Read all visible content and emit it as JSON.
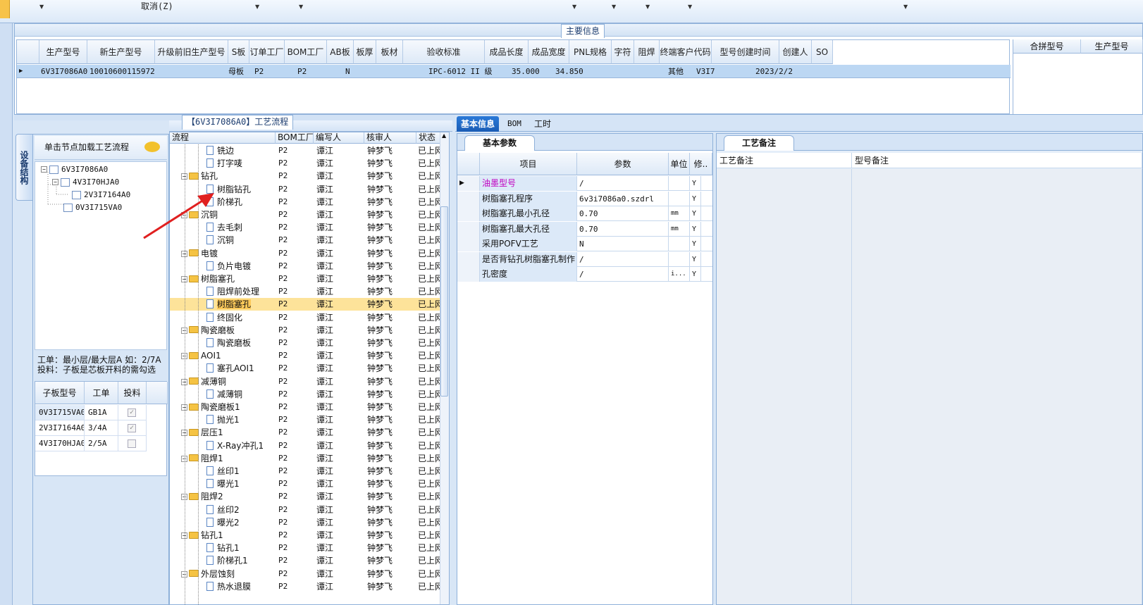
{
  "toolbar": {
    "cancel_label": "取消(Z)"
  },
  "main_info": {
    "title": "主要信息",
    "columns": [
      "生产型号",
      "新生产型号",
      "升级前旧生产型号",
      "S板",
      "订单工厂",
      "BOM工厂",
      "AB板",
      "板厚",
      "板材",
      "验收标准",
      "成品长度",
      "成品宽度",
      "PNL规格",
      "字符",
      "阻焊",
      "终端客户代码",
      "型号创建时间",
      "创建人",
      "SO"
    ],
    "row": {
      "prod_model": "6V3I7086A0",
      "new_model": "10010600115972",
      "old_model": "",
      "s_board": "母板",
      "order_factory": "P2",
      "bom_factory": "P2",
      "ab": "N",
      "thickness": "",
      "material": "",
      "standard": "IPC-6012 II 级",
      "length": "35.000",
      "width": "34.850",
      "pnl": "",
      "char": "",
      "mask": "其他",
      "customer": "V3I7",
      "created": "2023/2/2",
      "creator": "",
      "so": ""
    },
    "right_columns": [
      "合拼型号",
      "生产型号"
    ]
  },
  "structure": {
    "tab_label": "设备结构",
    "hint": "单击节点加载工艺流程",
    "tree": [
      "6V3I7086A0",
      "4V3I70HJA0",
      "2V3I7164A0",
      "0V3I715VA0"
    ],
    "info_line1": "工单：最小层/最大层A 如：2/7A",
    "info_line2": "投料：子板是芯板开料的需勾选",
    "sub_columns": [
      "子板型号",
      "工单",
      "投料"
    ],
    "sub_rows": [
      {
        "model": "0V3I715VA0",
        "order": "GB1A",
        "checked": true
      },
      {
        "model": "2V3I7164A0",
        "order": "3/4A",
        "checked": true
      },
      {
        "model": "4V3I70HJA0",
        "order": "2/5A",
        "checked": false
      }
    ]
  },
  "process": {
    "title": "【6V3I7086A0】工艺流程",
    "columns": [
      "流程",
      "BOM工厂",
      "编写人",
      "核审人",
      "状态"
    ],
    "default_factory": "P2",
    "default_writer": "谭江",
    "default_reviewer": "钟梦飞",
    "default_status": "已上网",
    "rows": [
      {
        "name": "铣边",
        "level": 2
      },
      {
        "name": "打字唛",
        "level": 2
      },
      {
        "name": "钻孔",
        "level": 1
      },
      {
        "name": "树脂钻孔",
        "level": 2
      },
      {
        "name": "阶梯孔",
        "level": 2
      },
      {
        "name": "沉铜",
        "level": 1
      },
      {
        "name": "去毛刺",
        "level": 2
      },
      {
        "name": "沉铜",
        "level": 2
      },
      {
        "name": "电镀",
        "level": 1
      },
      {
        "name": "负片电镀",
        "level": 2
      },
      {
        "name": "树脂塞孔",
        "level": 1
      },
      {
        "name": "阻焊前处理",
        "level": 2
      },
      {
        "name": "树脂塞孔",
        "level": 2,
        "selected": true
      },
      {
        "name": "终固化",
        "level": 2
      },
      {
        "name": "陶瓷磨板",
        "level": 1
      },
      {
        "name": "陶瓷磨板",
        "level": 2
      },
      {
        "name": "AOI1",
        "level": 1
      },
      {
        "name": "塞孔AOI1",
        "level": 2
      },
      {
        "name": "减薄铜",
        "level": 1
      },
      {
        "name": "减薄铜",
        "level": 2
      },
      {
        "name": "陶瓷磨板1",
        "level": 1
      },
      {
        "name": "抛光1",
        "level": 2
      },
      {
        "name": "层压1",
        "level": 1
      },
      {
        "name": "X-Ray冲孔1",
        "level": 2
      },
      {
        "name": "阻焊1",
        "level": 1
      },
      {
        "name": "丝印1",
        "level": 2
      },
      {
        "name": "曝光1",
        "level": 2
      },
      {
        "name": "阻焊2",
        "level": 1
      },
      {
        "name": "丝印2",
        "level": 2
      },
      {
        "name": "曝光2",
        "level": 2
      },
      {
        "name": "钻孔1",
        "level": 1
      },
      {
        "name": "钻孔1",
        "level": 2
      },
      {
        "name": "阶梯孔1",
        "level": 2
      },
      {
        "name": "外层蚀刻",
        "level": 1
      },
      {
        "name": "热水退膜",
        "level": 2
      }
    ]
  },
  "right_tabs": [
    "基本信息",
    "BOM",
    "工时"
  ],
  "basic": {
    "tab": "基本参数",
    "columns": [
      "项目",
      "参数",
      "单位",
      "修.."
    ],
    "rows": [
      {
        "item": "油墨型号",
        "param": "/",
        "unit": "",
        "rev": "Y",
        "pink": true
      },
      {
        "item": "树脂塞孔程序",
        "param": "6v3i7086a0.szdrl",
        "unit": "",
        "rev": "Y"
      },
      {
        "item": "树脂塞孔最小孔径",
        "param": "0.70",
        "unit": "mm",
        "rev": "Y"
      },
      {
        "item": "树脂塞孔最大孔径",
        "param": "0.70",
        "unit": "mm",
        "rev": "Y"
      },
      {
        "item": "采用POFV工艺",
        "param": "N",
        "unit": "",
        "rev": "Y"
      },
      {
        "item": "是否背钻孔树脂塞孔制作",
        "param": "/",
        "unit": "",
        "rev": "Y"
      },
      {
        "item": "孔密度",
        "param": "/",
        "unit": "i...",
        "rev": "Y"
      }
    ]
  },
  "memo": {
    "tab": "工艺备注",
    "col1": "工艺备注",
    "col2": "型号备注"
  },
  "colors": {
    "accent": "#1a5cb5",
    "selected_row": "#fde39a",
    "grid_selected": "#bcd7f3",
    "pink_text": "#c000c0",
    "arrow": "#e02020"
  }
}
